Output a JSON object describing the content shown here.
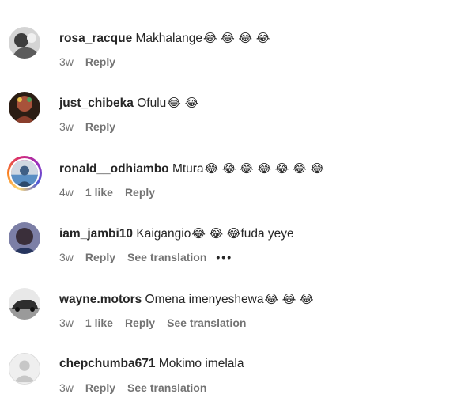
{
  "comments": [
    {
      "username": "rosa_racque",
      "text": "Makhalange",
      "emojis": "😂 😂 😂 😂",
      "time": "3w",
      "likes": "",
      "reply": "Reply",
      "translate": "",
      "more": "",
      "avatar_colors": [
        "#d9d9d9",
        "#6b6b6b"
      ]
    },
    {
      "username": "just_chibeka",
      "text": "Ofulu",
      "emojis": "😂 😂",
      "time": "3w",
      "likes": "",
      "reply": "Reply",
      "translate": "",
      "more": "",
      "avatar_colors": [
        "#3b2a1f",
        "#b0624a"
      ]
    },
    {
      "username": "ronald__odhiambo",
      "text": "Mtura",
      "emojis": "😂 😂 😂 😂 😂 😂 😂",
      "time": "4w",
      "likes": "1 like",
      "reply": "Reply",
      "translate": "",
      "more": "",
      "avatar_colors": [
        "#5a8fc4",
        "#cfd8e2"
      ]
    },
    {
      "username": "iam_jambi10",
      "text": "Kaigangio",
      "emojis": "😂 😂 😂",
      "text_after": "fuda yeye",
      "time": "3w",
      "likes": "",
      "reply": "Reply",
      "translate": "See translation",
      "more": "•••",
      "avatar_colors": [
        "#2a3a66",
        "#8a7a9a"
      ]
    },
    {
      "username": "wayne.motors",
      "text": "Omena imenyeshewa",
      "emojis": "😂 😂 😂",
      "time": "3w",
      "likes": "1 like",
      "reply": "Reply",
      "translate": "See translation",
      "more": "",
      "avatar_colors": [
        "#e8e8e8",
        "#2e2e2e"
      ]
    },
    {
      "username": "chepchumba671",
      "text": "Mokimo imelala",
      "emojis": "",
      "time": "3w",
      "likes": "",
      "reply": "Reply",
      "translate": "See translation",
      "more": "",
      "avatar_colors": [
        "#efefef",
        "#c7c7c7"
      ]
    }
  ]
}
